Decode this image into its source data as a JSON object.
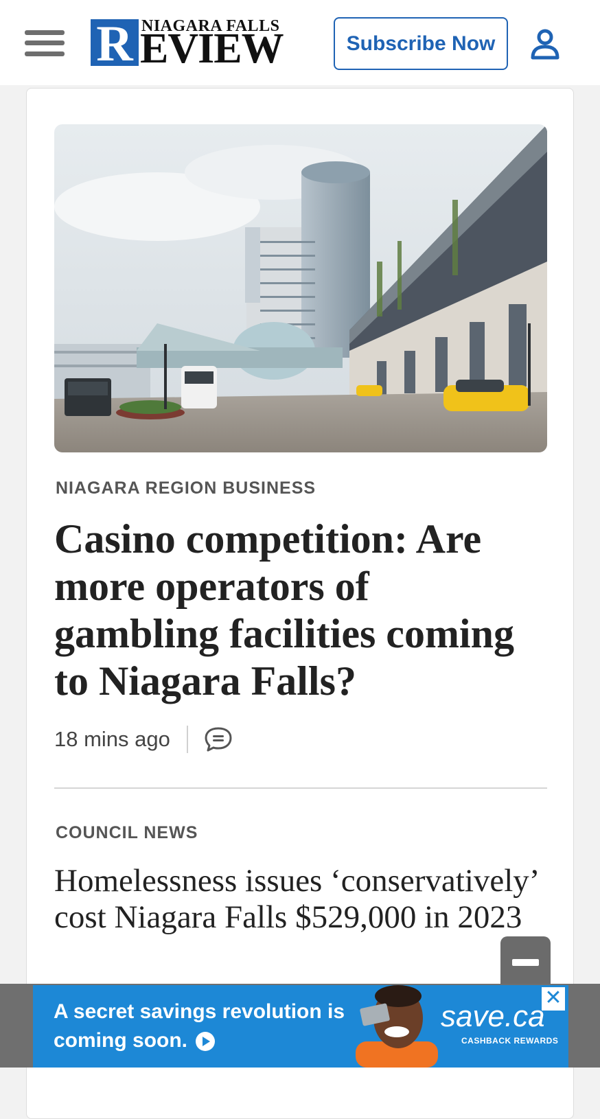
{
  "header": {
    "menu_icon": "hamburger-menu-icon",
    "logo": {
      "top_text": "NIAGARA FALLS",
      "initial": "R",
      "main_rest": "EVIEW"
    },
    "subscribe_label": "Subscribe Now",
    "account_icon": "user-account-icon"
  },
  "colors": {
    "brand_blue": "#1f63b4",
    "ad_blue": "#1d88d6"
  },
  "lead_story": {
    "image_alt": "Fallsview casino complex with taxis and glass dome entrance",
    "category": "NIAGARA REGION BUSINESS",
    "headline": "Casino competition: Are more operators of gambling facilities coming to Niagara Falls?",
    "timestamp": "18 mins ago",
    "comment_icon": "comment-bubble-icon"
  },
  "second_story": {
    "category": "COUNCIL NEWS",
    "headline": "Homelessness issues ‘conservatively’ cost Niagara Falls $529,000 in 2023"
  },
  "ad": {
    "text": "A secret savings revolution is coming soon.",
    "brand": "save.ca",
    "brand_sub": "CASHBACK REWARDS",
    "close_label": "✕"
  }
}
